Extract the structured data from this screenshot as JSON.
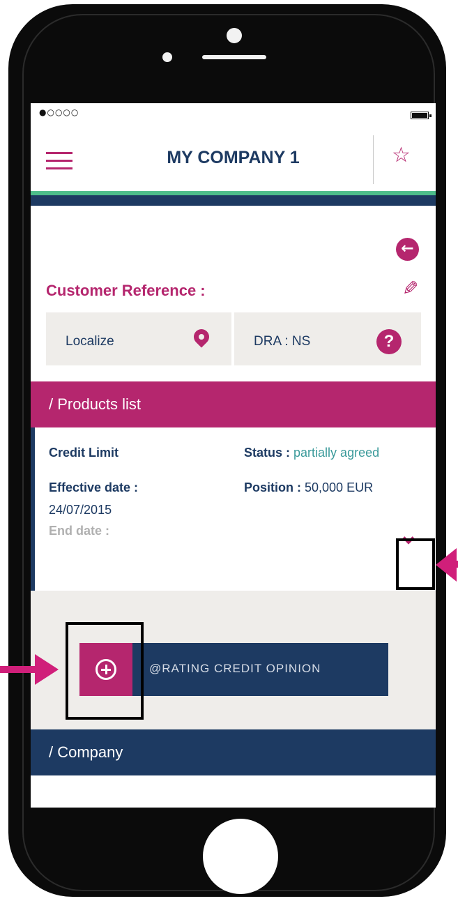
{
  "status_bar": {
    "signal": "●○○○○"
  },
  "header": {
    "title": "MY COMPANY 1"
  },
  "customer": {
    "reference_label": "Customer Reference :",
    "localize_label": "Localize",
    "dra_label": "DRA : NS",
    "help_symbol": "?"
  },
  "products": {
    "header": "/ Products list",
    "credit_limit": "Credit Limit",
    "status_label": "Status :",
    "status_value": "partially agreed",
    "effective_date_label": "Effective date :",
    "effective_date_value": "24/07/2015",
    "end_date_label": "End date :",
    "position_label": "Position :",
    "position_value": "50,000 EUR"
  },
  "rating": {
    "label": "@RATING CREDIT OPINION"
  },
  "company": {
    "header": "/ Company"
  },
  "colors": {
    "brand_magenta": "#b5266e",
    "brand_navy": "#1d3a62",
    "accent_green": "#4dbd8a",
    "status_teal": "#3a9a9a",
    "annotation_arrow": "#d01f7a"
  },
  "icons": [
    "menu-icon",
    "star-icon",
    "back-arrow-icon",
    "edit-pencil-icon",
    "location-pin-icon",
    "help-icon",
    "chevron-down-icon",
    "plus-circle-icon"
  ]
}
